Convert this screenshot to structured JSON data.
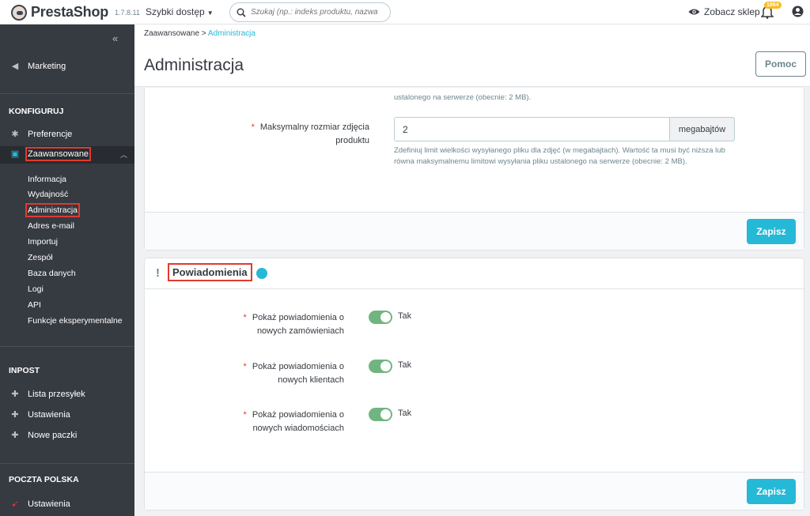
{
  "topbar": {
    "brand": "PrestaShop",
    "version": "1.7.8.11",
    "quick_access": "Szybki dostęp",
    "search_placeholder": "Szukaj (np.: indeks produktu, nazwa klienta...)",
    "view_shop": "Zobacz sklep",
    "notification_count": "1864"
  },
  "sidebar": {
    "marketing": "Marketing",
    "configure_heading": "KONFIGURUJ",
    "preferences": "Preferencje",
    "advanced": "Zaawansowane",
    "sub_items": [
      "Informacja",
      "Wydajność",
      "Administracja",
      "Adres e-mail",
      "Importuj",
      "Zespół",
      "Baza danych",
      "Logi",
      "API",
      "Funkcje eksperymentalne"
    ],
    "inpost_heading": "INPOST",
    "inpost_items": [
      "Lista przesyłek",
      "Ustawienia",
      "Nowe paczki"
    ],
    "poczta_heading": "POCZTA POLSKA",
    "poczta_items": [
      "Ustawienia"
    ]
  },
  "header": {
    "breadcrumb_parent": "Zaawansowane",
    "breadcrumb_sep": ">",
    "breadcrumb_current": "Administracja",
    "title": "Administracja",
    "help_button": "Pomoc"
  },
  "upload_panel": {
    "prev_help_tail": "ustalonego na serwerze (obecnie: 2 MB).",
    "field_label_line1": "Maksymalny rozmiar zdjęcia",
    "field_label_line2": "produktu",
    "field_value": "2",
    "field_unit": "megabajtów",
    "field_help": "Zdefiniuj limit wielkości wysyłanego pliku dla zdjęć (w megabajtach). Wartość ta musi być niższa lub równa maksymalnemu limitowi wysyłania pliku ustalonego na serwerze (obecnie: 2 MB).",
    "save": "Zapisz"
  },
  "notifications_panel": {
    "bang": "!",
    "title": "Powiadomienia",
    "rows": [
      {
        "line1": "Pokaż powiadomienia o",
        "line2": "nowych zamówieniach",
        "value": "Tak"
      },
      {
        "line1": "Pokaż powiadomienia o",
        "line2": "nowych klientach",
        "value": "Tak"
      },
      {
        "line1": "Pokaż powiadomienia o",
        "line2": "nowych wiadomościach",
        "value": "Tak"
      }
    ],
    "save": "Zapisz"
  },
  "colors": {
    "accent": "#25b9d7",
    "sidebar": "#363a41",
    "toggle_on": "#70b580",
    "highlight": "#e03a2f"
  }
}
